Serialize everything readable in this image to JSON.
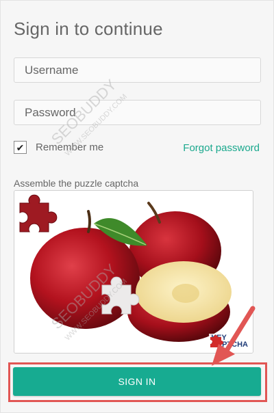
{
  "form": {
    "title": "Sign in to continue",
    "username_placeholder": "Username",
    "password_placeholder": "Password",
    "remember_label": "Remember me",
    "remember_checked": "✔",
    "forgot_link": "Forgot password",
    "captcha_label": "Assemble the puzzle captcha",
    "signin_label": "SIGN IN"
  },
  "captcha": {
    "brand_line1": "KEY",
    "brand_line2": "CAPTCHA"
  },
  "watermark": {
    "brand": "SEOBUDDY",
    "url": "WWW.SEOBUDDY.COM"
  },
  "colors": {
    "accent": "#17ab91",
    "link": "#1aa88d",
    "highlight": "#e15654"
  }
}
